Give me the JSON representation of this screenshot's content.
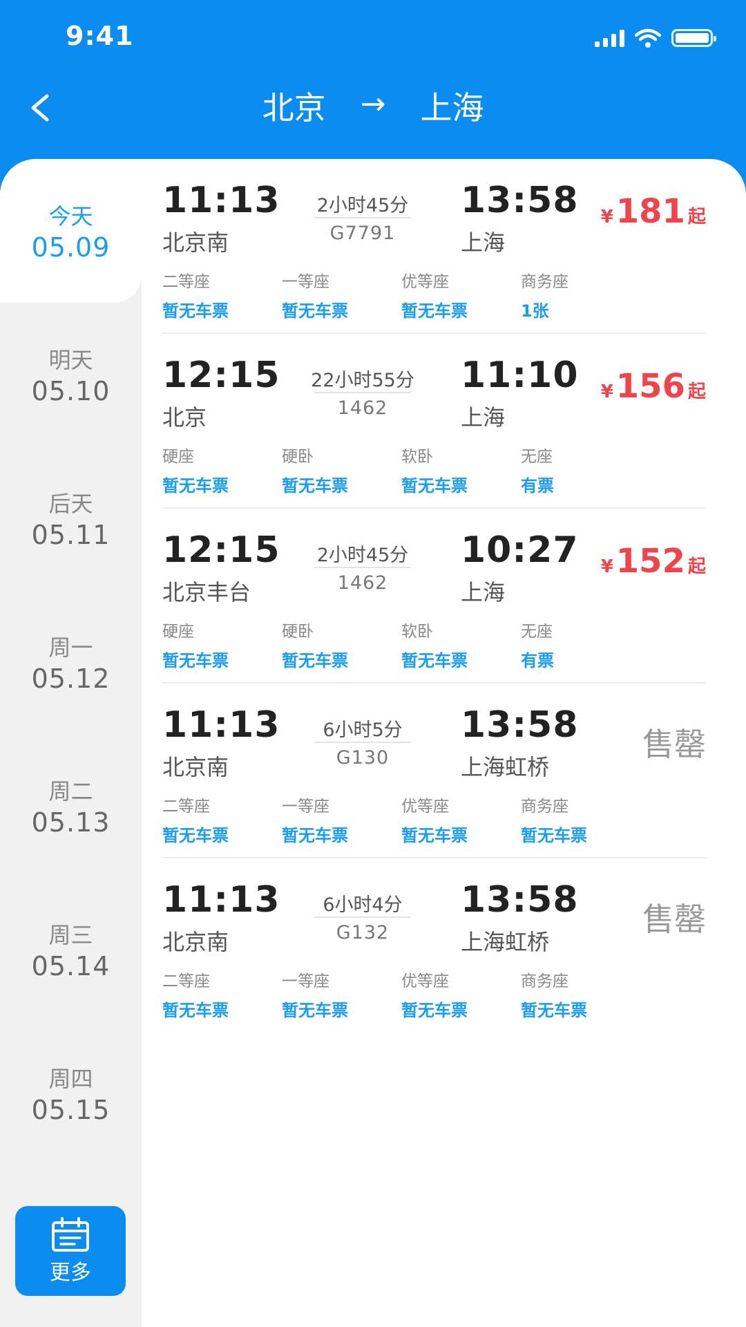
{
  "status_bar": {
    "time": "9:41"
  },
  "header": {
    "from": "北京",
    "arrow": "→",
    "to": "上海"
  },
  "dates": [
    {
      "day": "今天",
      "date": "05.09",
      "active": true
    },
    {
      "day": "明天",
      "date": "05.10"
    },
    {
      "day": "后天",
      "date": "05.11"
    },
    {
      "day": "周一",
      "date": "05.12"
    },
    {
      "day": "周二",
      "date": "05.13"
    },
    {
      "day": "周三",
      "date": "05.14"
    },
    {
      "day": "周四",
      "date": "05.15"
    }
  ],
  "more_button": {
    "label": "更多",
    "icon": "calendar-icon"
  },
  "trains": [
    {
      "dep_time": "11:13",
      "dep_station": "北京南",
      "duration": "2小时45分",
      "number": "G7791",
      "arr_time": "13:58",
      "arr_station": "上海",
      "price": {
        "currency": "¥",
        "amount": "181",
        "suffix": "起"
      },
      "status": "",
      "seats": [
        {
          "name": "二等座",
          "avail": "暂无车票"
        },
        {
          "name": "一等座",
          "avail": "暂无车票"
        },
        {
          "name": "优等座",
          "avail": "暂无车票"
        },
        {
          "name": "商务座",
          "avail": "1张"
        }
      ]
    },
    {
      "dep_time": "12:15",
      "dep_station": "北京",
      "duration": "22小时55分",
      "number": "1462",
      "arr_time": "11:10",
      "arr_station": "上海",
      "price": {
        "currency": "¥",
        "amount": "156",
        "suffix": "起"
      },
      "status": "",
      "seats": [
        {
          "name": "硬座",
          "avail": "暂无车票"
        },
        {
          "name": "硬卧",
          "avail": "暂无车票"
        },
        {
          "name": "软卧",
          "avail": "暂无车票"
        },
        {
          "name": "无座",
          "avail": "有票"
        }
      ]
    },
    {
      "dep_time": "12:15",
      "dep_station": "北京丰台",
      "duration": "2小时45分",
      "number": "1462",
      "arr_time": "10:27",
      "arr_station": "上海",
      "price": {
        "currency": "¥",
        "amount": "152",
        "suffix": "起"
      },
      "status": "",
      "seats": [
        {
          "name": "硬座",
          "avail": "暂无车票"
        },
        {
          "name": "硬卧",
          "avail": "暂无车票"
        },
        {
          "name": "软卧",
          "avail": "暂无车票"
        },
        {
          "name": "无座",
          "avail": "有票"
        }
      ]
    },
    {
      "dep_time": "11:13",
      "dep_station": "北京南",
      "duration": "6小时5分",
      "number": "G130",
      "arr_time": "13:58",
      "arr_station": "上海虹桥",
      "price": null,
      "status": "售罄",
      "seats": [
        {
          "name": "二等座",
          "avail": "暂无车票"
        },
        {
          "name": "一等座",
          "avail": "暂无车票"
        },
        {
          "name": "优等座",
          "avail": "暂无车票"
        },
        {
          "name": "商务座",
          "avail": "暂无车票"
        }
      ]
    },
    {
      "dep_time": "11:13",
      "dep_station": "北京南",
      "duration": "6小时4分",
      "number": "G132",
      "arr_time": "13:58",
      "arr_station": "上海虹桥",
      "price": null,
      "status": "售罄",
      "seats": [
        {
          "name": "二等座",
          "avail": "暂无车票"
        },
        {
          "name": "一等座",
          "avail": "暂无车票"
        },
        {
          "name": "优等座",
          "avail": "暂无车票"
        },
        {
          "name": "商务座",
          "avail": "暂无车票"
        }
      ]
    }
  ],
  "colors": {
    "brand": "#0a8cf0",
    "accent_blue": "#1a9cf0",
    "price_red": "#f0434a",
    "sold_out_gray": "#999999",
    "rail_bg": "#f1f1f1"
  }
}
